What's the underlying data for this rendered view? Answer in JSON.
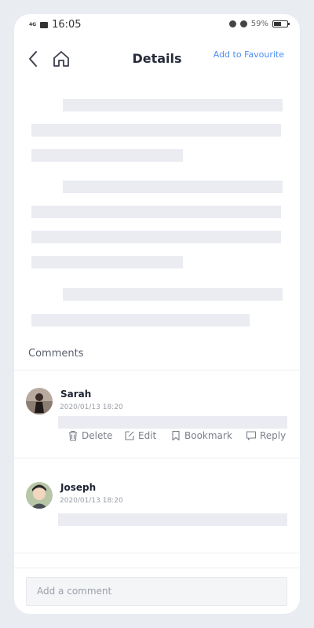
{
  "status_bar": {
    "network": "4G",
    "time": "16:05",
    "battery_percent": "59%",
    "battery_level": 0.59
  },
  "header": {
    "title": "Details",
    "favourite_link": "Add to Favourite"
  },
  "comments": {
    "section_title": "Comments",
    "items": [
      {
        "name": "Sarah",
        "date": "2020/01/13 18:20",
        "actions": {
          "delete": "Delete",
          "edit": "Edit",
          "bookmark": "Bookmark",
          "reply": "Reply"
        }
      },
      {
        "name": "Joseph",
        "date": "2020/01/13 18:20"
      }
    ]
  },
  "input": {
    "placeholder": "Add a comment"
  },
  "colors": {
    "accent": "#4c8df0",
    "skeleton": "#eaecf2",
    "title": "#262b3a"
  }
}
